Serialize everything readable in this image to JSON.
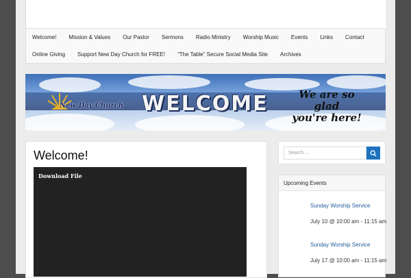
{
  "nav": {
    "row1": [
      "Welcome!",
      "Mission & Values",
      "Our Pastor",
      "Sermons",
      "Radio Ministry",
      "Worship Music",
      "Events",
      "Links",
      "Contact"
    ],
    "row2": [
      "Online Giving",
      "Support New Day Church for FREE!",
      "“The Table” Secure Social Media Site",
      "Archives"
    ]
  },
  "banner": {
    "logo_text": "New Day Church",
    "welcome": "WELCOME",
    "glad_line1": "We are so glad",
    "glad_line2": "you're here!"
  },
  "main": {
    "title": "Welcome!",
    "download_label": "Download File"
  },
  "search": {
    "placeholder": "Search ...",
    "icon": "search-icon"
  },
  "events": {
    "heading": "Upcoming Events",
    "items": [
      {
        "title": "Sunday Worship Service",
        "date": "July 10 @ 10:00 am - 11:15 am"
      },
      {
        "title": "Sunday Worship Service",
        "date": "July 17 @ 10:00 am - 11:15 am"
      }
    ]
  },
  "colors": {
    "accent": "#1e73be",
    "background": "#4d4d4d"
  }
}
